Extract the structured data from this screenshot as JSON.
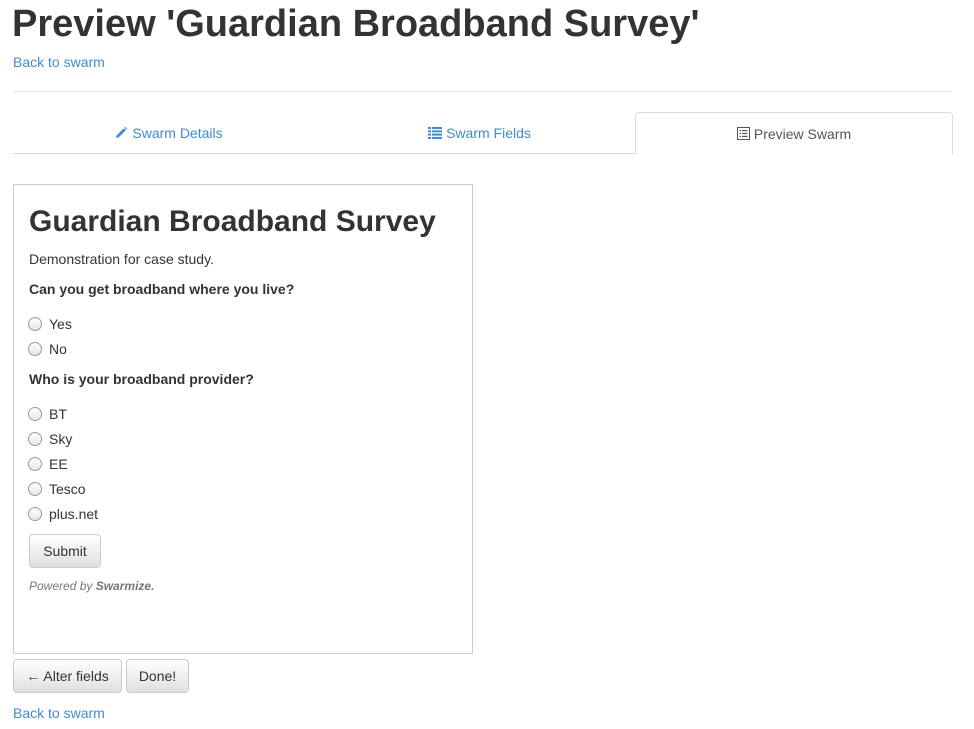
{
  "page": {
    "title": "Preview 'Guardian Broadband Survey'",
    "back_link": "Back to swarm"
  },
  "tabs": [
    {
      "label": "Swarm Details",
      "icon": "pencil-icon",
      "active": false
    },
    {
      "label": "Swarm Fields",
      "icon": "list-icon",
      "active": false
    },
    {
      "label": "Preview Swarm",
      "icon": "list-alt-icon",
      "active": true
    }
  ],
  "preview": {
    "title": "Guardian Broadband Survey",
    "description": "Demonstration for case study.",
    "questions": [
      {
        "label": "Can you get broadband where you live?",
        "options": [
          "Yes",
          "No"
        ]
      },
      {
        "label": "Who is your broadband provider?",
        "options": [
          "BT",
          "Sky",
          "EE",
          "Tesco",
          "plus.net"
        ]
      }
    ],
    "submit_label": "Submit",
    "powered_prefix": "Powered by",
    "powered_brand": "Swarmize."
  },
  "actions": {
    "alter_fields": "← Alter fields",
    "done": "Done!"
  },
  "footer": {
    "back_link": "Back to swarm"
  },
  "colors": {
    "link": "#428bca",
    "text": "#333333",
    "border": "#dddddd"
  }
}
